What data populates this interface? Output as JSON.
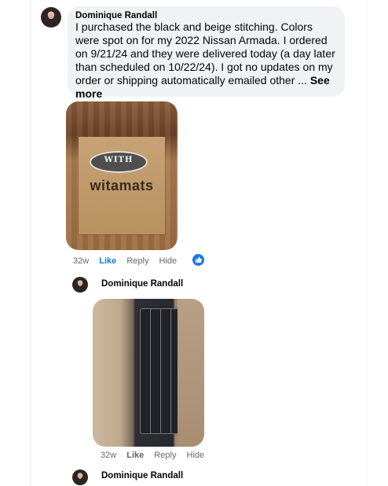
{
  "comment": {
    "author": "Dominique Randall",
    "text": "I purchased the black and beige stitching. Colors were spot on for my 2022 Nissan Armada. I ordered on 9/21/24 and they were delivered today (a day later than scheduled on 10/22/24). I got no updates on my order or shipping automatically emailed other ...",
    "see_more": "See more"
  },
  "photo_1": {
    "badge_text": "WITH",
    "brand_text": "witamats",
    "icon": "photo-icon"
  },
  "comment_actions": {
    "time": "32w",
    "like": "Like",
    "reply": "Reply",
    "hide": "Hide",
    "reaction_icon": "thumbs-up-icon",
    "accent": "#1877f2"
  },
  "reply_1": {
    "author": "Dominique Randall",
    "photo_icon": "photo-icon"
  },
  "reply_1_actions": {
    "time": "32w",
    "like": "Like",
    "reply": "Reply",
    "hide": "Hide"
  },
  "reply_2": {
    "author": "Dominique Randall"
  }
}
